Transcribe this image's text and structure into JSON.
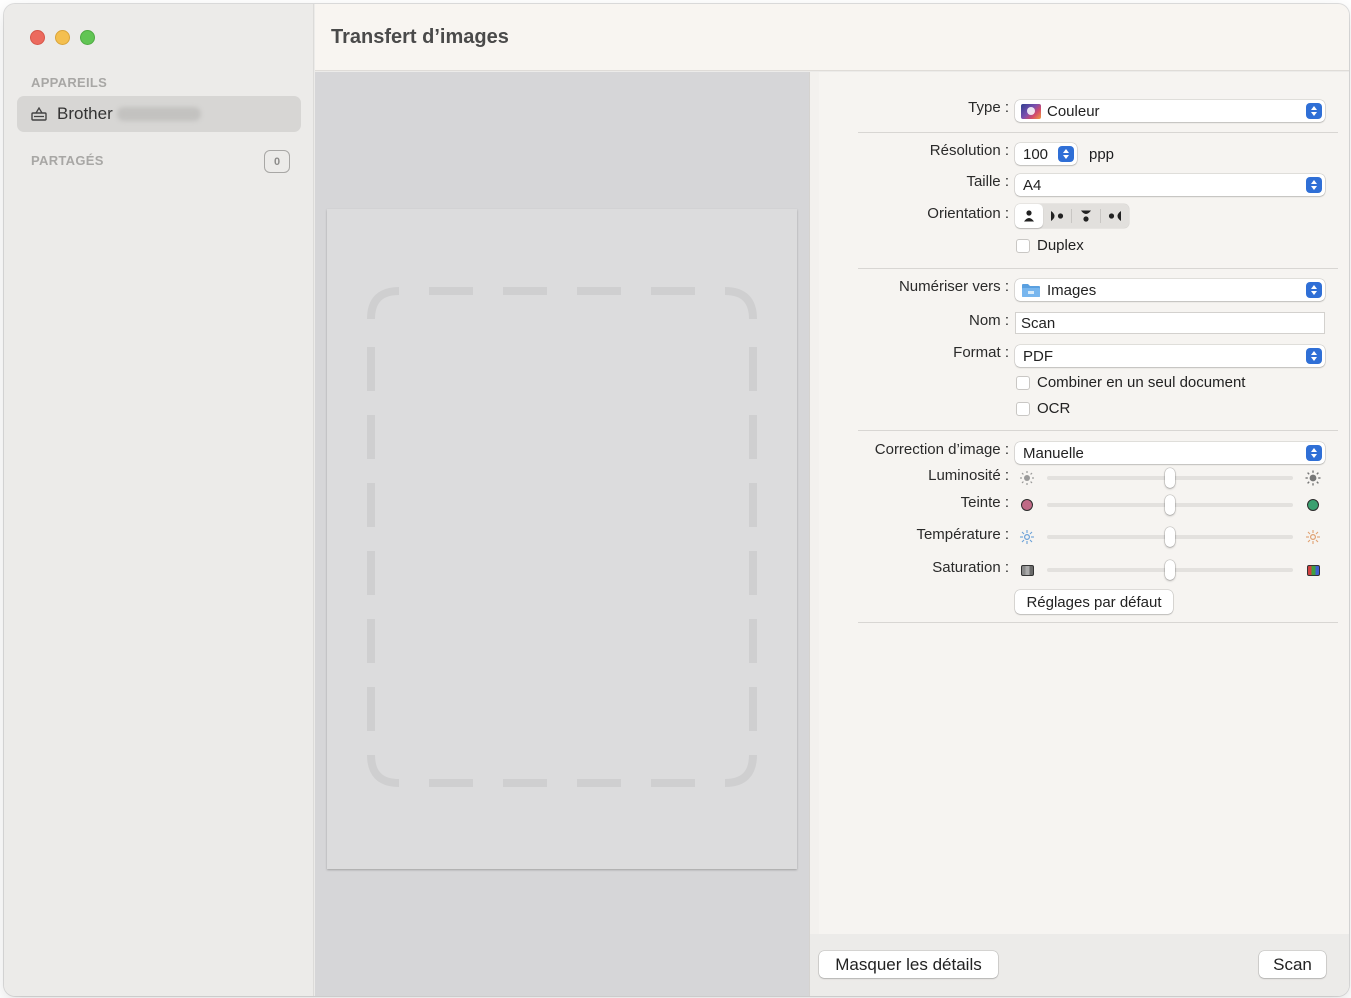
{
  "window": {
    "title": "Transfert d’images"
  },
  "sidebar": {
    "devices_header": "APPAREILS",
    "device_name": "Brother",
    "shared_header": "PARTAGÉS",
    "shared_count": "0"
  },
  "settings": {
    "type": {
      "label": "Type :",
      "value": "Couleur"
    },
    "resolution": {
      "label": "Résolution :",
      "value": "100",
      "unit": "ppp"
    },
    "size": {
      "label": "Taille :",
      "value": "A4"
    },
    "orientation": {
      "label": "Orientation :"
    },
    "duplex": {
      "label": "Duplex",
      "checked": false
    },
    "scan_to": {
      "label": "Numériser vers :",
      "value": "Images"
    },
    "name": {
      "label": "Nom :",
      "value": "Scan"
    },
    "format": {
      "label": "Format :",
      "value": "PDF"
    },
    "combine": {
      "label": "Combiner en un seul document",
      "checked": false
    },
    "ocr": {
      "label": "OCR",
      "checked": false
    },
    "image_correction": {
      "label": "Correction d’image :",
      "value": "Manuelle"
    },
    "brightness": {
      "label": "Luminosité :",
      "level": 0.5
    },
    "tint": {
      "label": "Teinte :",
      "level": 0.5
    },
    "temperature": {
      "label": "Température :",
      "level": 0.5
    },
    "saturation": {
      "label": "Saturation :",
      "level": 0.5
    },
    "defaults_button": "Réglages par défaut"
  },
  "footer": {
    "hide_details_button": "Masquer les détails",
    "scan_button": "Scan"
  },
  "colors": {
    "accent": "#2f6fd6",
    "tint_left": "#c06a86",
    "tint_right": "#3aa070"
  }
}
